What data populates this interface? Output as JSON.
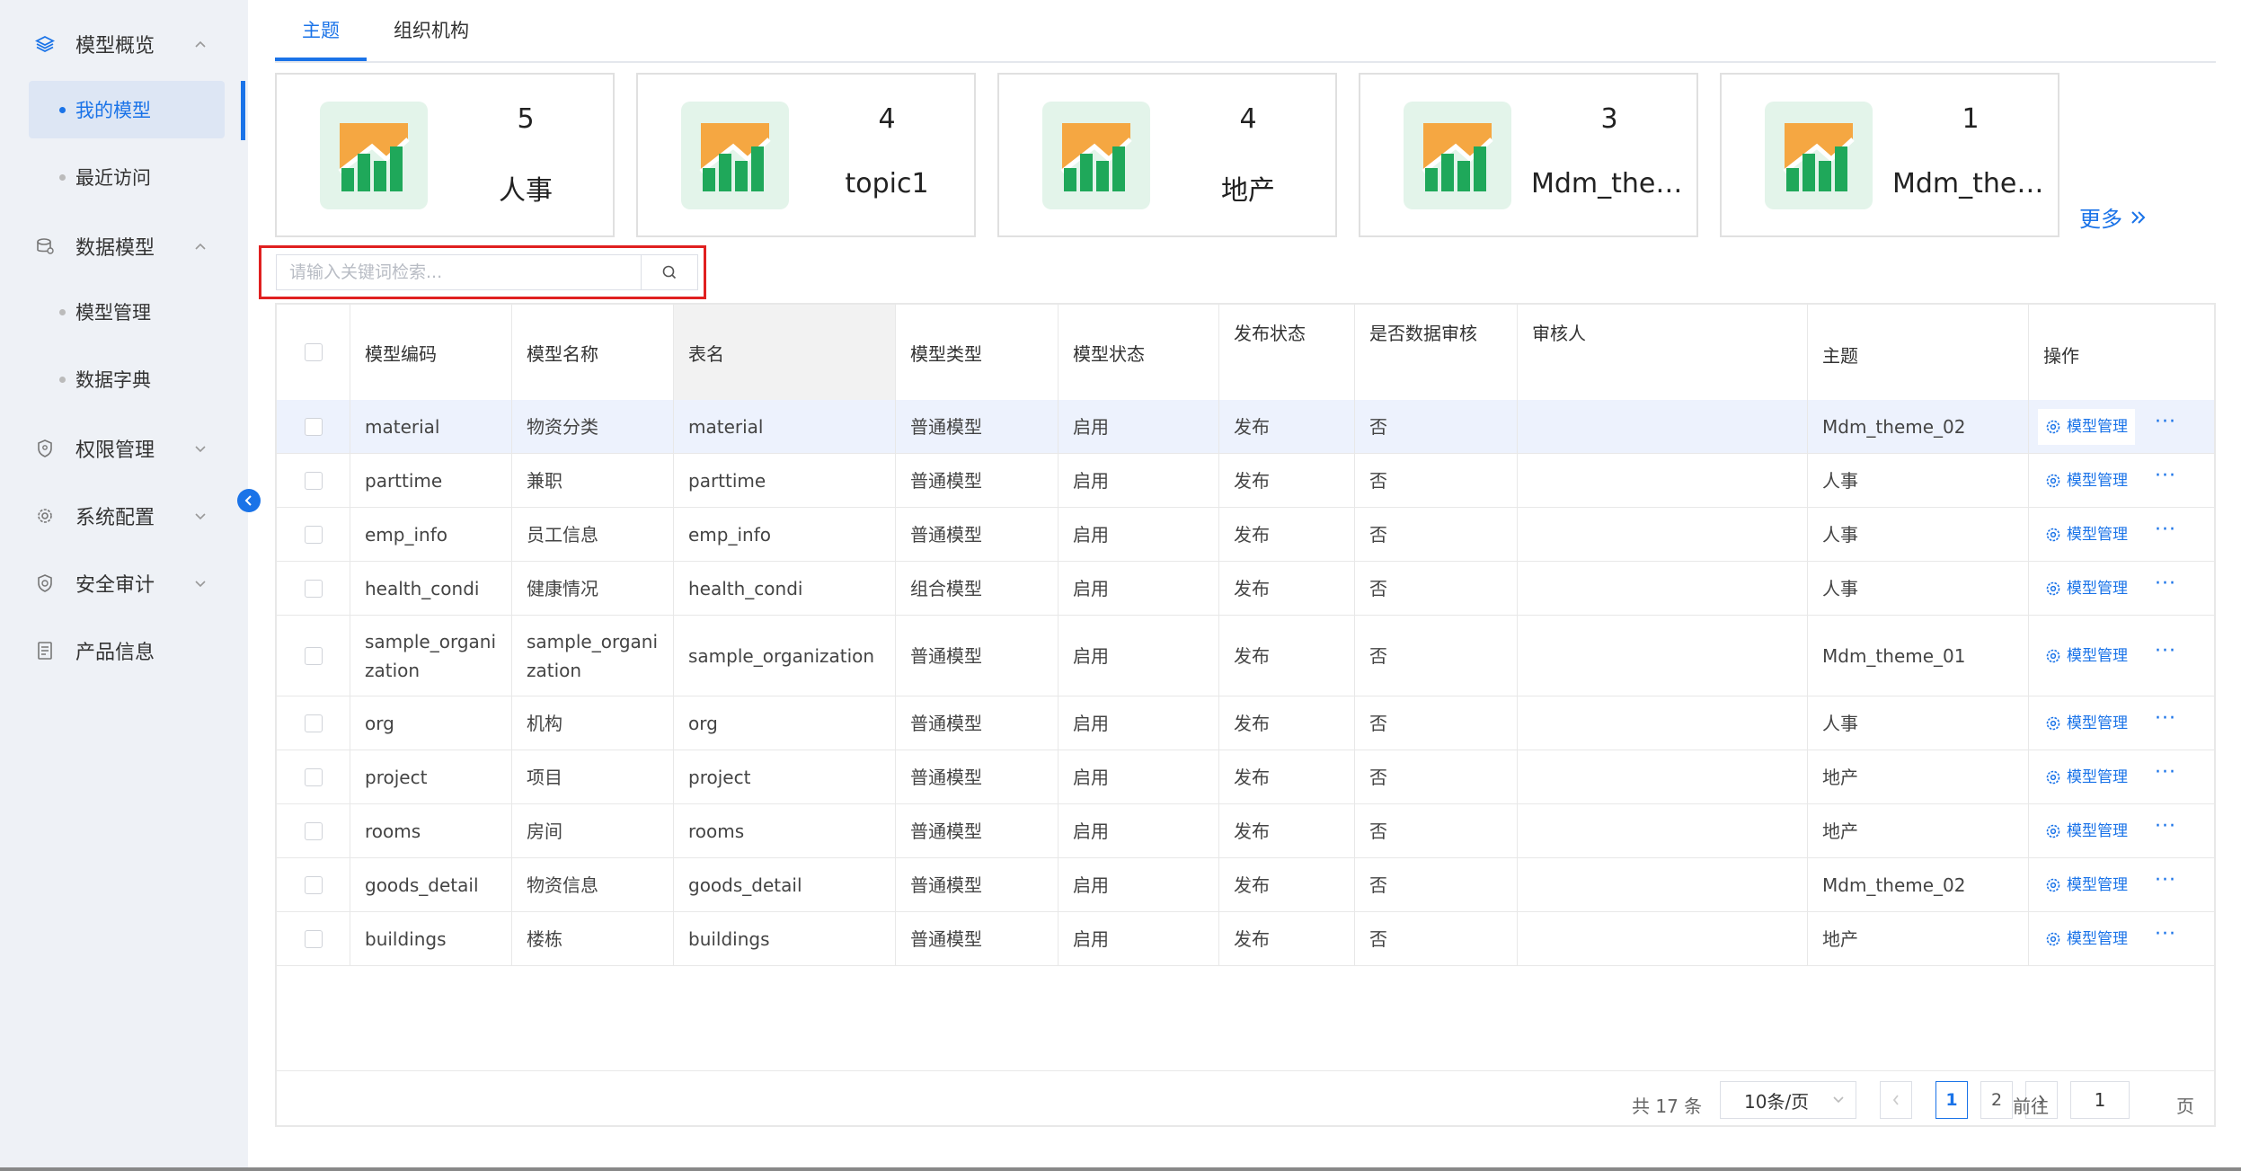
{
  "sidebar": {
    "groups": [
      {
        "label": "模型概览",
        "icon": "layers-icon",
        "expanded": true
      },
      {
        "label": "数据模型",
        "icon": "database-icon",
        "expanded": true
      },
      {
        "label": "权限管理",
        "icon": "shield-icon",
        "expanded": false
      },
      {
        "label": "系统配置",
        "icon": "gear-icon",
        "expanded": false
      },
      {
        "label": "安全审计",
        "icon": "security-icon",
        "expanded": false
      },
      {
        "label": "产品信息",
        "icon": "document-icon",
        "expanded": false
      }
    ],
    "sub_items": [
      {
        "label": "我的模型",
        "active": true
      },
      {
        "label": "最近访问",
        "active": false
      },
      {
        "label": "模型管理",
        "active": false
      },
      {
        "label": "数据字典",
        "active": false
      }
    ]
  },
  "tabs": [
    {
      "label": "主题",
      "active": true
    },
    {
      "label": "组织机构",
      "active": false
    }
  ],
  "cards": [
    {
      "count": "5",
      "name": "人事"
    },
    {
      "count": "4",
      "name": "topic1"
    },
    {
      "count": "4",
      "name": "地产"
    },
    {
      "count": "3",
      "name": "Mdm_them..."
    },
    {
      "count": "1",
      "name": "Mdm_them..."
    }
  ],
  "more_label": "更多",
  "search": {
    "placeholder": "请输入关键词检索...",
    "value": ""
  },
  "table": {
    "headers": [
      "模型编码",
      "模型名称",
      "表名",
      "模型类型",
      "模型状态",
      "发布状态",
      "是否数据审核",
      "审核人",
      "主题",
      "操作"
    ],
    "action_label": "模型管理",
    "rows": [
      {
        "code": "material",
        "name": "物资分类",
        "table": "material",
        "type": "普通模型",
        "status": "启用",
        "publish": "发布",
        "audit": "否",
        "auditor": "",
        "theme": "Mdm_theme_02"
      },
      {
        "code": "parttime",
        "name": "兼职",
        "table": "parttime",
        "type": "普通模型",
        "status": "启用",
        "publish": "发布",
        "audit": "否",
        "auditor": "",
        "theme": "人事"
      },
      {
        "code": "emp_info",
        "name": "员工信息",
        "table": "emp_info",
        "type": "普通模型",
        "status": "启用",
        "publish": "发布",
        "audit": "否",
        "auditor": "",
        "theme": "人事"
      },
      {
        "code": "health_condi",
        "name": "健康情况",
        "table": "health_condi",
        "type": "组合模型",
        "status": "启用",
        "publish": "发布",
        "audit": "否",
        "auditor": "",
        "theme": "人事"
      },
      {
        "code": "sample_organization",
        "name": "sample_organization",
        "table": "sample_organization",
        "type": "普通模型",
        "status": "启用",
        "publish": "发布",
        "audit": "否",
        "auditor": "",
        "theme": "Mdm_theme_01"
      },
      {
        "code": "org",
        "name": "机构",
        "table": "org",
        "type": "普通模型",
        "status": "启用",
        "publish": "发布",
        "audit": "否",
        "auditor": "",
        "theme": "人事"
      },
      {
        "code": "project",
        "name": "项目",
        "table": "project",
        "type": "普通模型",
        "status": "启用",
        "publish": "发布",
        "audit": "否",
        "auditor": "",
        "theme": "地产"
      },
      {
        "code": "rooms",
        "name": "房间",
        "table": "rooms",
        "type": "普通模型",
        "status": "启用",
        "publish": "发布",
        "audit": "否",
        "auditor": "",
        "theme": "地产"
      },
      {
        "code": "goods_detail",
        "name": "物资信息",
        "table": "goods_detail",
        "type": "普通模型",
        "status": "启用",
        "publish": "发布",
        "audit": "否",
        "auditor": "",
        "theme": "Mdm_theme_02"
      },
      {
        "code": "buildings",
        "name": "楼栋",
        "table": "buildings",
        "type": "普通模型",
        "status": "启用",
        "publish": "发布",
        "audit": "否",
        "auditor": "",
        "theme": "地产"
      }
    ]
  },
  "pagination": {
    "total_text": "共 17 条",
    "page_size": "10条/页",
    "pages": [
      "1",
      "2"
    ],
    "current": "1",
    "goto_prefix": "前往",
    "goto_value": "1",
    "goto_suffix": "页"
  },
  "colors": {
    "accent": "#1a73e8",
    "icon_orange": "#f5a742",
    "icon_green": "#1fa85a",
    "highlight_border": "#e02020"
  }
}
